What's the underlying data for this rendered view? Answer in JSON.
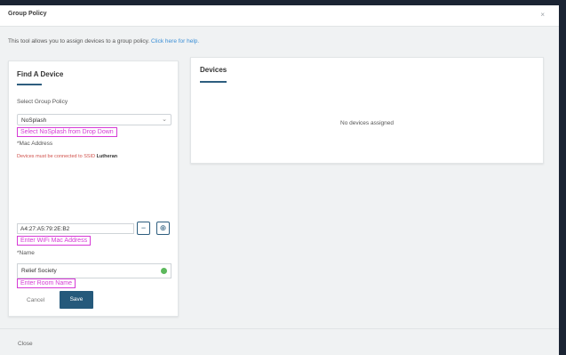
{
  "modal": {
    "title": "Group Policy",
    "close_glyph": "×",
    "intro_text": "This tool allows you to assign devices to a group policy.",
    "help_link": "Click here for help."
  },
  "find_device": {
    "title": "Find A Device",
    "select_label": "Select Group Policy",
    "select_value": "NoSplash",
    "select_annotation": "Select NoSplash from Drop Down",
    "mac_label": "*Mac Address",
    "mac_hint_text": "Devices must be connected to SSID",
    "mac_hint_ssid": "Lutheran",
    "mac_value": "A4:27:A5:79:2E:B2",
    "mac_annotation": "Enter WiFi Mac Address",
    "minus_glyph": "−",
    "plus_glyph": "⊕",
    "name_label": "*Name",
    "name_value": "Relief Society",
    "name_annotation": "Enter Room Name",
    "cancel_label": "Cancel",
    "save_label": "Save"
  },
  "devices": {
    "title": "Devices",
    "empty_text": "No devices assigned"
  },
  "footer": {
    "close_label": "Close"
  },
  "colors": {
    "accent": "#25597b",
    "annotation": "#d63ad6",
    "link": "#3b8fd6",
    "valid": "#5cb85c"
  }
}
